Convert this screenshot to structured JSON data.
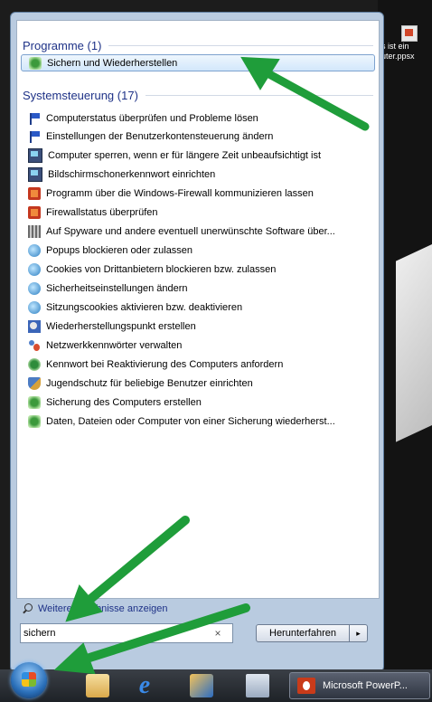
{
  "programs": {
    "header": "Programme (1)",
    "items": [
      {
        "label": "Sichern und Wiederherstellen",
        "icon": "backup-restore-icon"
      }
    ]
  },
  "control_panel": {
    "header": "Systemsteuerung (17)",
    "items": [
      {
        "label": "Computerstatus überprüfen und Probleme lösen",
        "icon": "action-center-flag-icon"
      },
      {
        "label": "Einstellungen der Benutzerkontensteuerung ändern",
        "icon": "action-center-flag-icon"
      },
      {
        "label": "Computer sperren, wenn er für längere Zeit unbeaufsichtigt ist",
        "icon": "monitor-icon"
      },
      {
        "label": "Bildschirmschonerkennwort einrichten",
        "icon": "monitor-icon"
      },
      {
        "label": "Programm über die Windows-Firewall kommunizieren lassen",
        "icon": "firewall-icon"
      },
      {
        "label": "Firewallstatus überprüfen",
        "icon": "firewall-icon"
      },
      {
        "label": "Auf Spyware und andere eventuell unerwünschte Software über...",
        "icon": "defender-icon"
      },
      {
        "label": "Popups blockieren oder zulassen",
        "icon": "internet-options-icon"
      },
      {
        "label": "Cookies von Drittanbietern blockieren bzw. zulassen",
        "icon": "internet-options-icon"
      },
      {
        "label": "Sicherheitseinstellungen ändern",
        "icon": "internet-options-icon"
      },
      {
        "label": "Sitzungscookies aktivieren bzw. deaktivieren",
        "icon": "internet-options-icon"
      },
      {
        "label": "Wiederherstellungspunkt erstellen",
        "icon": "system-restore-icon"
      },
      {
        "label": "Netzwerkkennwörter verwalten",
        "icon": "user-accounts-icon"
      },
      {
        "label": "Kennwort bei Reaktivierung des Computers anfordern",
        "icon": "power-options-icon"
      },
      {
        "label": "Jugendschutz für beliebige Benutzer einrichten",
        "icon": "parental-controls-icon"
      },
      {
        "label": "Sicherung des Computers erstellen",
        "icon": "backup-restore-icon"
      },
      {
        "label": "Daten, Dateien oder Computer von einer Sicherung wiederherst...",
        "icon": "backup-restore-icon"
      }
    ]
  },
  "more_results": "Weitere Ergebnisse anzeigen",
  "search": {
    "value": "sichern",
    "clear": "×"
  },
  "shutdown": {
    "label": "Herunterfahren",
    "arrow": "▸"
  },
  "desktop_file": {
    "line1": "s ist ein",
    "line2": "uter.ppsx"
  },
  "taskbar": {
    "task_label": "Microsoft PowerP..."
  },
  "colors": {
    "annotation_arrow": "#1f9d3a",
    "section_header": "#1e3287",
    "menu_frame": "#b9cbe0"
  }
}
